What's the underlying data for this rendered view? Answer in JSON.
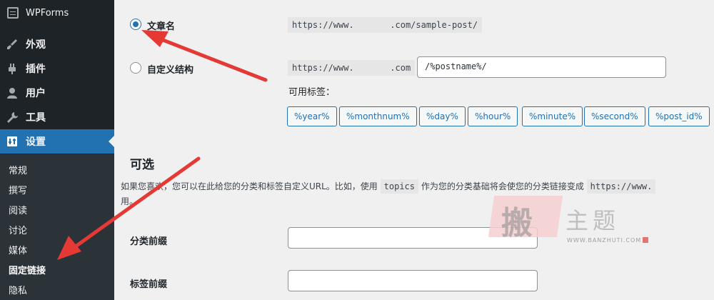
{
  "sidebar": {
    "brand": "WPForms",
    "menu": [
      {
        "label": "外观",
        "icon": "paintbrush-icon"
      },
      {
        "label": "插件",
        "icon": "plugin-icon"
      },
      {
        "label": "用户",
        "icon": "user-icon"
      },
      {
        "label": "工具",
        "icon": "wrench-icon"
      },
      {
        "label": "设置",
        "icon": "settings-icon"
      }
    ],
    "submenu": [
      "常规",
      "撰写",
      "阅读",
      "讨论",
      "媒体",
      "固定链接",
      "隐私"
    ]
  },
  "permalink": {
    "post_name": {
      "label": "文章名",
      "example": "https://www.       .com/sample-post/",
      "checked": true
    },
    "custom": {
      "label": "自定义结构",
      "prefix": "https://www.       .com",
      "value": "/%postname%/"
    },
    "available_tags_label": "可用标签：",
    "tags": [
      "%year%",
      "%monthnum%",
      "%day%",
      "%hour%",
      "%minute%",
      "%second%",
      "%post_id%"
    ]
  },
  "optional": {
    "title": "可选",
    "desc_part1": "如果您喜欢，您可以在此给您的分类和标签自定义URL。比如，使用",
    "desc_code1": "topics",
    "desc_part2": "作为您的分类基础将会使您的分类链接变成",
    "desc_code2": "https://www.",
    "desc_line2": "用。",
    "category_base_label": "分类前缀",
    "tag_base_label": "标签前缀"
  },
  "watermark": {
    "seal_char": "搬",
    "title": "主题",
    "url": "WWW.BANZHUTI.COM"
  },
  "colors": {
    "accent": "#2271b1",
    "arrow": "#e53935",
    "sidebar_bg": "#1d2327"
  }
}
